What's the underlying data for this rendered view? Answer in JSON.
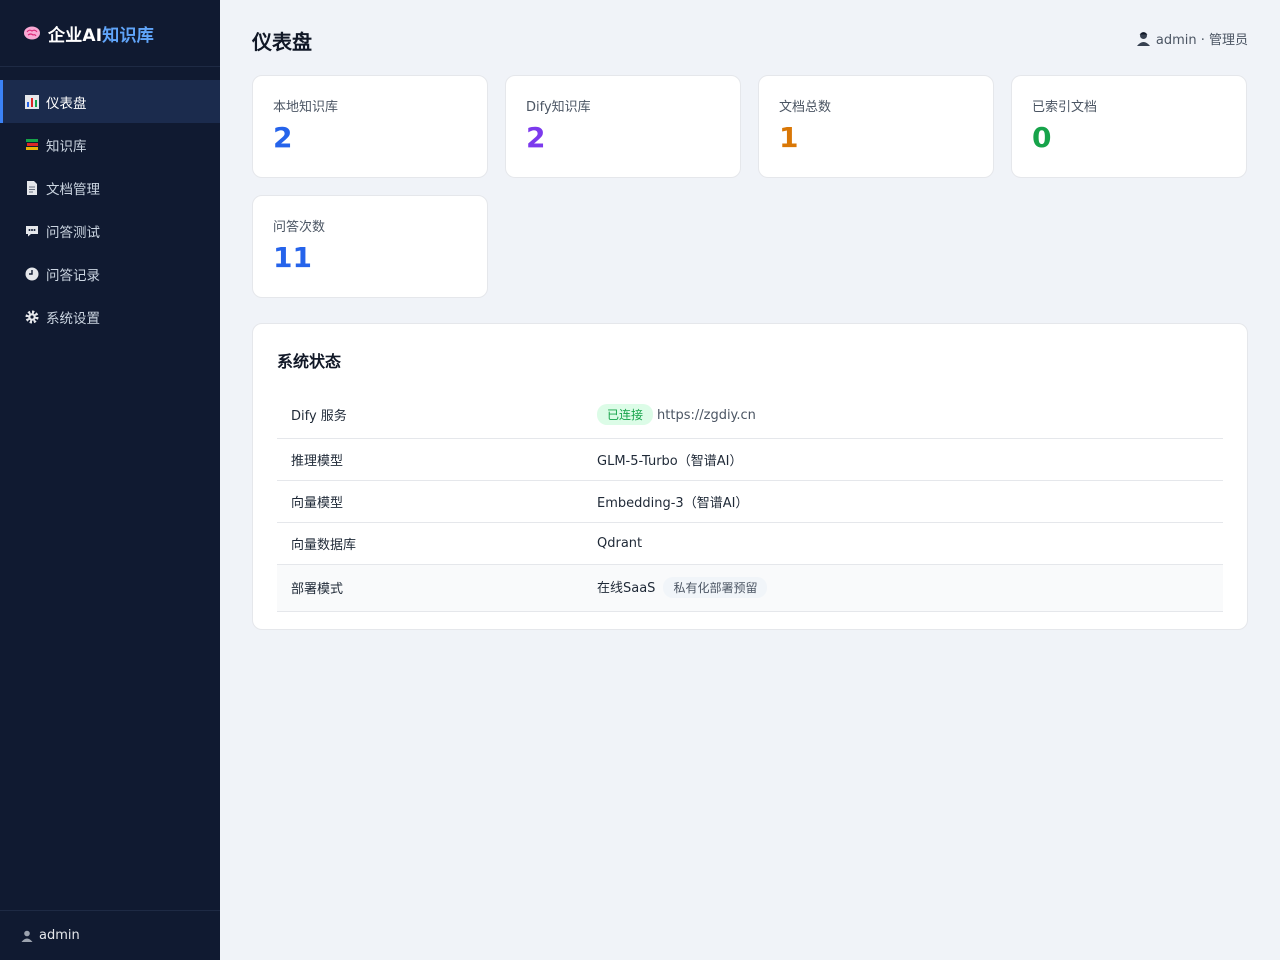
{
  "brand": {
    "prefix": "企业AI",
    "accent": "知识库"
  },
  "sidebar": {
    "items": [
      {
        "icon": "bar-chart-icon",
        "label": "仪表盘",
        "active": true
      },
      {
        "icon": "books-icon",
        "label": "知识库"
      },
      {
        "icon": "document-icon",
        "label": "文档管理"
      },
      {
        "icon": "chat-icon",
        "label": "问答测试"
      },
      {
        "icon": "clock-icon",
        "label": "问答记录"
      },
      {
        "icon": "gear-icon",
        "label": "系统设置"
      }
    ],
    "footer_user": "admin"
  },
  "header": {
    "title": "仪表盘",
    "user_text": "admin · 管理员"
  },
  "stats": [
    {
      "label": "本地知识库",
      "value": "2",
      "color": "#2563eb"
    },
    {
      "label": "Dify知识库",
      "value": "2",
      "color": "#7c3aed"
    },
    {
      "label": "文档总数",
      "value": "1",
      "color": "#d97706"
    },
    {
      "label": "已索引文档",
      "value": "0",
      "color": "#16a34a"
    },
    {
      "label": "问答次数",
      "value": "11",
      "color": "#2563eb"
    }
  ],
  "system_status": {
    "title": "系统状态",
    "rows": [
      {
        "key": "Dify 服务",
        "badge": "已连接",
        "value": "https://zgdiy.cn"
      },
      {
        "key": "推理模型",
        "value": "GLM-5-Turbo（智谱AI）"
      },
      {
        "key": "向量模型",
        "value": "Embedding-3（智谱AI）"
      },
      {
        "key": "向量数据库",
        "value": "Qdrant"
      },
      {
        "key": "部署模式",
        "value": "在线SaaS",
        "tag": "私有化部署预留"
      }
    ]
  }
}
